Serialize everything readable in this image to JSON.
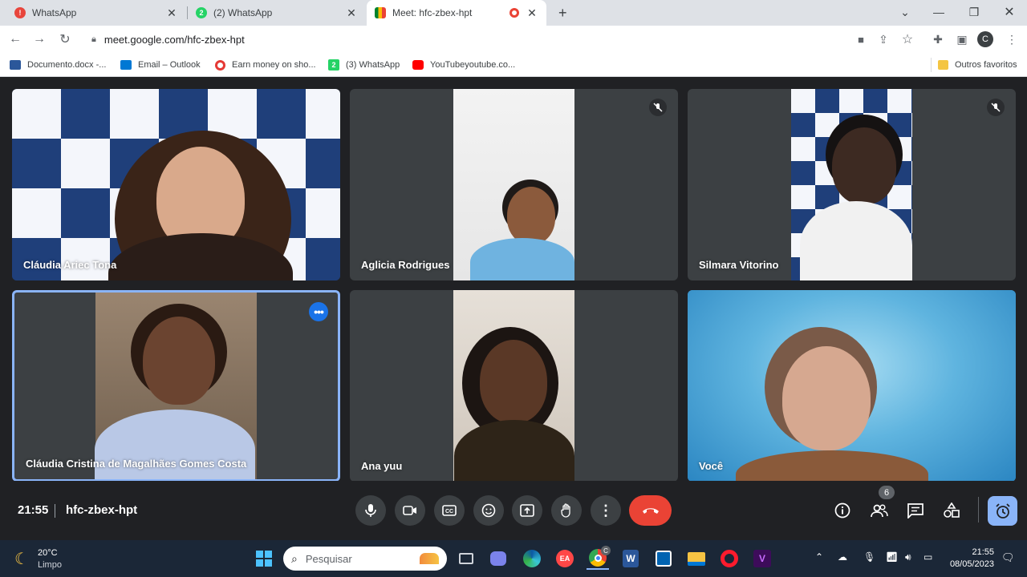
{
  "browser": {
    "tabs": [
      {
        "title": "WhatsApp",
        "icon": "recording-dot-icon"
      },
      {
        "title": "(2) WhatsApp",
        "icon": "whatsapp-icon",
        "badge": "2"
      },
      {
        "title": "Meet: hfc-zbex-hpt",
        "icon": "meet-icon",
        "active": true
      }
    ],
    "new_tab": "+",
    "url": "meet.google.com/hfc-zbex-hpt",
    "profile_initial": "C",
    "bookmarks": [
      {
        "label": "Documento.docx -...",
        "icon": "word-icon",
        "color": "#2b579a"
      },
      {
        "label": "Email – Outlook",
        "icon": "outlook-icon",
        "color": "#0078d4"
      },
      {
        "label": "Earn money on sho...",
        "icon": "earn-icon",
        "color": "#e53935"
      },
      {
        "label": "(3) WhatsApp",
        "icon": "whatsapp-icon",
        "color": "#25d366",
        "badge": "2"
      },
      {
        "label": "YouTubeyoutube.co...",
        "icon": "youtube-icon",
        "color": "#ff0000"
      }
    ],
    "other_bookmarks": "Outros favoritos"
  },
  "meet": {
    "participants": [
      {
        "name": "Cláudia Ariec Tona",
        "muted": false
      },
      {
        "name": "Aglicia Rodrigues",
        "muted": true
      },
      {
        "name": "Silmara Vitorino",
        "muted": true
      },
      {
        "name": "Cláudia Cristina de Magalhães Gomes Costa",
        "muted": false,
        "active_speaker": true
      },
      {
        "name": "Ana yuu",
        "muted": false
      },
      {
        "name": "Você",
        "muted": false
      }
    ],
    "time": "21:55",
    "meeting_code": "hfc-zbex-hpt",
    "participant_count": "6",
    "colors": {
      "end_call": "#ea4335",
      "accent": "#8ab4f8",
      "tile": "#3c4043"
    }
  },
  "taskbar": {
    "weather_temp": "20°C",
    "weather_desc": "Limpo",
    "search_placeholder": "Pesquisar",
    "chrome_badge": "C",
    "time": "21:55",
    "date": "08/05/2023"
  }
}
